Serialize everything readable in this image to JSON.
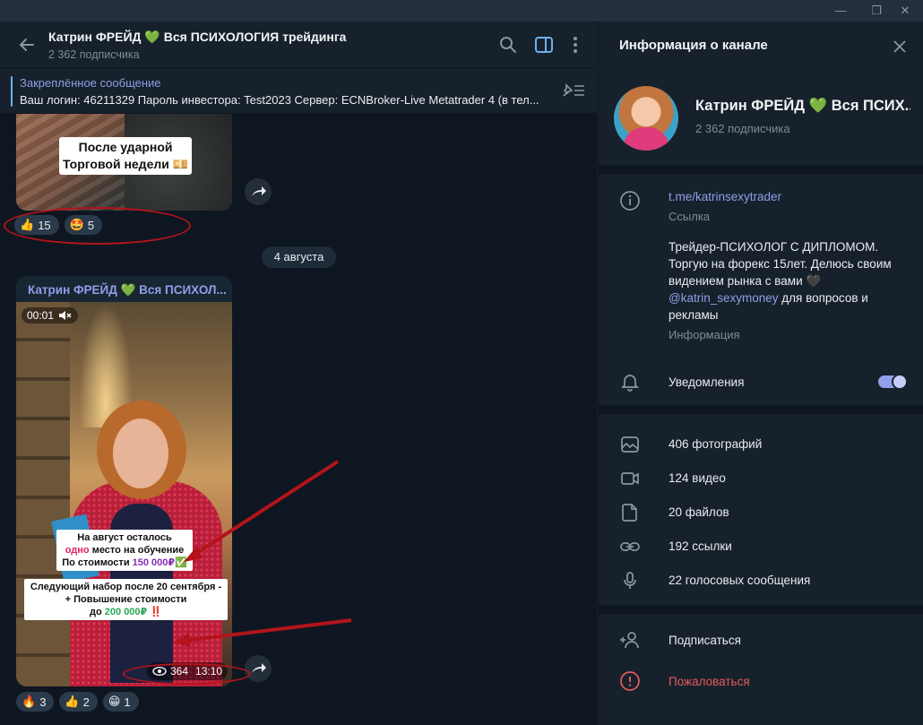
{
  "window": {
    "minimize": "—",
    "maximize": "❐",
    "close": "✕"
  },
  "chat": {
    "title": "Катрин ФРЕЙД 💚 Вся ПСИХОЛОГИЯ трейдинга",
    "subscribers": "2 362 подписчика"
  },
  "pinned": {
    "title": "Закреплённое сообщение",
    "text": "Ваш логин: 46211329 Пароль инвестора: Test2023 Сервер: ECNBroker-Live Metatrader 4 (в тел..."
  },
  "messages": {
    "photo_caption_line1": "После ударной",
    "photo_caption_line2": "Торговой недели 💴",
    "photo_reactions": [
      {
        "emoji": "👍",
        "count": "15"
      },
      {
        "emoji": "🤩",
        "count": "5"
      }
    ],
    "date": "4 августа",
    "video_author": "Катрин ФРЕЙД 💚 Вся ПСИХОЛ...",
    "video_time": "00:01",
    "overlay1": {
      "line1": "На август осталось",
      "line2_highlight": "одно",
      "line2_rest": " место на обучение",
      "line3_prefix": "По стоимости ",
      "line3_price": "150 000₽",
      "line3_suffix": "✅"
    },
    "overlay2": {
      "line1": "Следующий набор после 20 сентября -",
      "line2": "+ Повышение стоимости",
      "line3_prefix": "до ",
      "line3_price": "200 000₽",
      "line3_suffix": " ‼️"
    },
    "video_views": "364",
    "video_clock": "13:10",
    "video_reactions": [
      {
        "emoji": "🔥",
        "count": "3"
      },
      {
        "emoji": "👍",
        "count": "2"
      },
      {
        "emoji": "😁",
        "count": "1"
      }
    ]
  },
  "info": {
    "header": "Информация о канале",
    "channel_title": "Катрин ФРЕЙД 💚 Вся ПСИХ...",
    "subscribers": "2 362 подписчика",
    "link": "t.me/katrinsexytrader",
    "link_label": "Ссылка",
    "bio_text": "Трейдер-ПСИХОЛОГ С ДИПЛОМОМ. Торгую на форекс 15лет. Делюсь своим видением рынка с вами 🖤",
    "bio_mention": "@katrin_sexymoney",
    "bio_tail": " для вопросов и рекламы",
    "bio_label": "Информация",
    "notifications": "Уведомления",
    "notifications_on": true,
    "media": {
      "photos": "406 фотографий",
      "videos": "124 видео",
      "files": "20 файлов",
      "links": "192 ссылки",
      "voice": "22 голосовых сообщения"
    },
    "subscribe": "Подписаться",
    "report": "Пожаловаться"
  },
  "colors": {
    "accent": "#8f9fe8",
    "danger": "#e55b5b",
    "annotation_red": "#b3141b"
  }
}
